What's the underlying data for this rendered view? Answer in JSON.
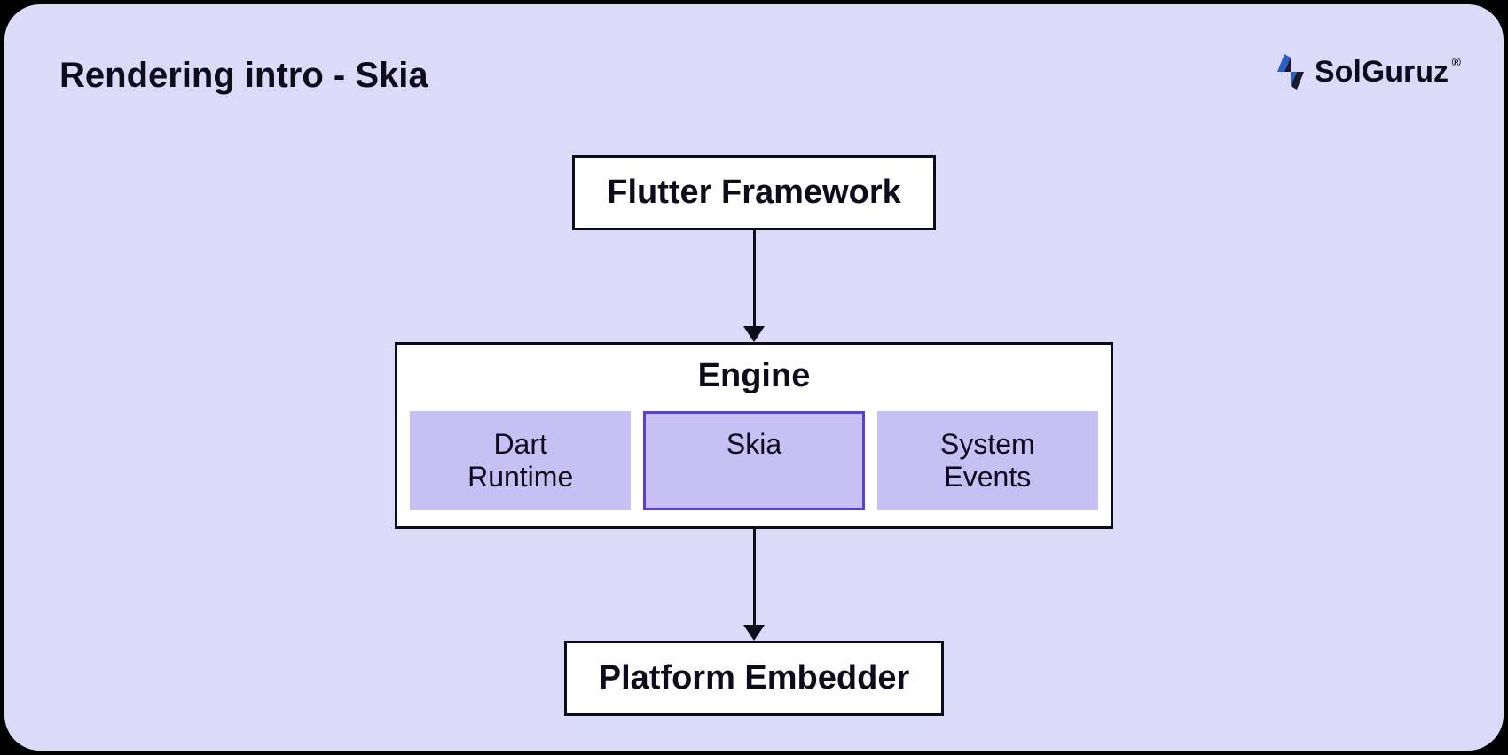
{
  "title": "Rendering intro - Skia",
  "logo": {
    "brand": "SolGuruz",
    "registered": "®"
  },
  "diagram": {
    "top_box": "Flutter Framework",
    "engine": {
      "title": "Engine",
      "items": [
        {
          "label": "Dart Runtime",
          "highlighted": false
        },
        {
          "label": "Skia",
          "highlighted": true
        },
        {
          "label": "System Events",
          "highlighted": false
        }
      ]
    },
    "bottom_box": "Platform Embedder"
  }
}
